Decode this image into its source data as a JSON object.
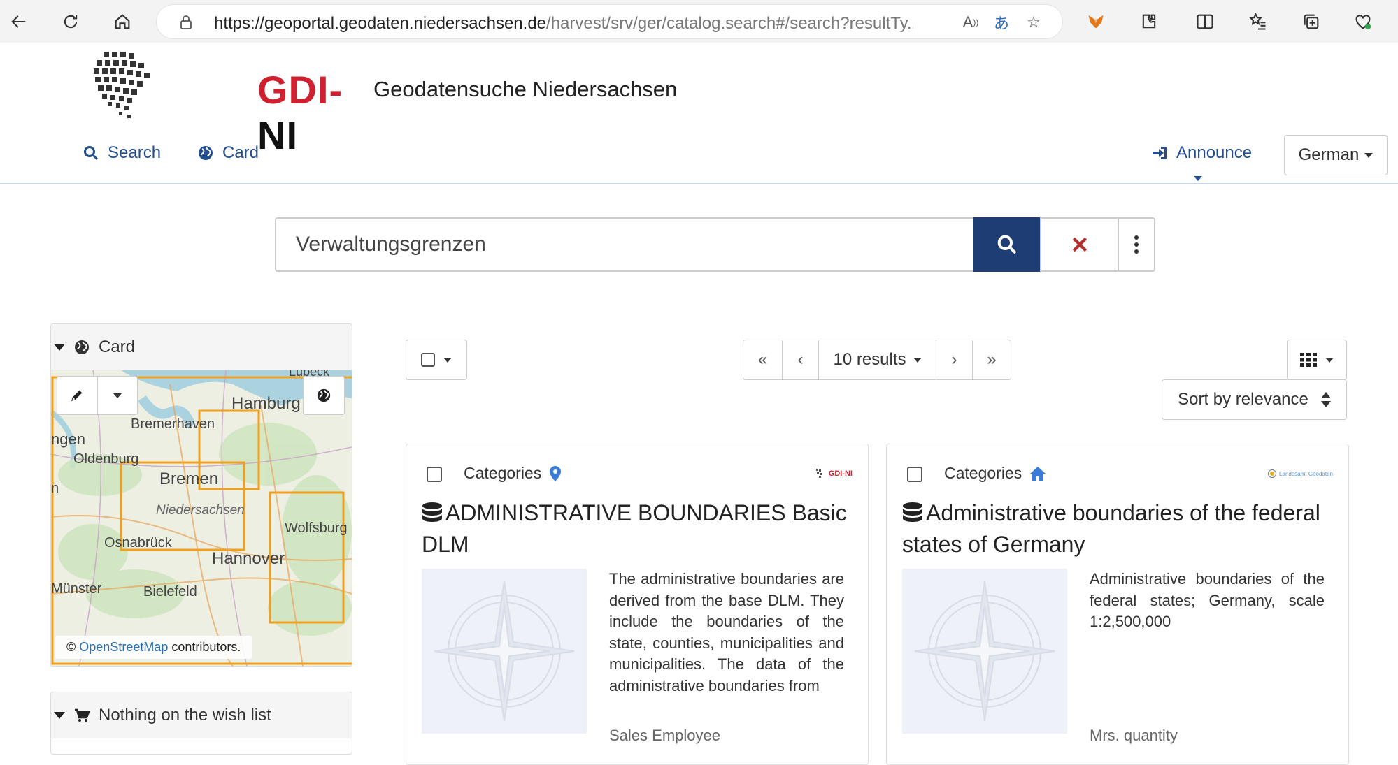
{
  "browser": {
    "url_domain": "https://geoportal.geodaten.niedersachsen.de",
    "url_path": "/harvest/srv/ger/catalog.search#/search?resultTy..."
  },
  "header": {
    "logo_text_red": "GDI-",
    "logo_text_black": "NI",
    "site_title": "Geodatensuche Niedersachsen",
    "nav": {
      "search_label": "Search",
      "card_label": "Card",
      "announce_label": "Announce",
      "language_label": "German"
    }
  },
  "search": {
    "query": "Verwaltungsgrenzen"
  },
  "sidebar": {
    "map_panel_title": "Card",
    "map_labels": {
      "top": "Lübeck",
      "hamburg": "Hamburg",
      "bremerhaven": "Bremerhaven",
      "left_cut": "ngen",
      "oldenburg": "Oldenburg",
      "bremen": "Bremen",
      "left_cut2": "n",
      "niedersachsen": "Niedersachsen",
      "wolfsburg": "Wolfsburg",
      "osnabrueck": "Osnabrück",
      "hannover": "Hannover",
      "muenster": "Münster",
      "bielefeld": "Bielefeld"
    },
    "map_attribution_prefix": "©",
    "map_attribution_link": "OpenStreetMap",
    "map_attribution_suffix": "contributors.",
    "wishlist_title": "Nothing on the wish list"
  },
  "results": {
    "pager_label": "10 results",
    "sort_label": "Sort by relevance",
    "cards": [
      {
        "category_label": "Categories",
        "title": "ADMINISTRATIVE BOUNDARIES Basic DLM",
        "abstract": "The administrative boundaries are derived from the base DLM. They include the boundaries of the state, counties, municipalities and municipalities. The data of the administrative boundaries from",
        "contact": "Sales Employee",
        "source_logo": "GDI-NI"
      },
      {
        "category_label": "Categories",
        "title": "Administrative boundaries of the federal states of Germany",
        "abstract": "Administrative boundaries of the federal states; Germany, scale 1:2,500,000",
        "contact": "Mrs. quantity",
        "source_logo": "Landesamt Geodaten"
      }
    ]
  },
  "colors": {
    "nav_blue": "#234d8d",
    "search_button": "#1f3d75",
    "clear_red": "#b3312c",
    "logo_red": "#d0202f",
    "map_box": "#f0a020"
  }
}
